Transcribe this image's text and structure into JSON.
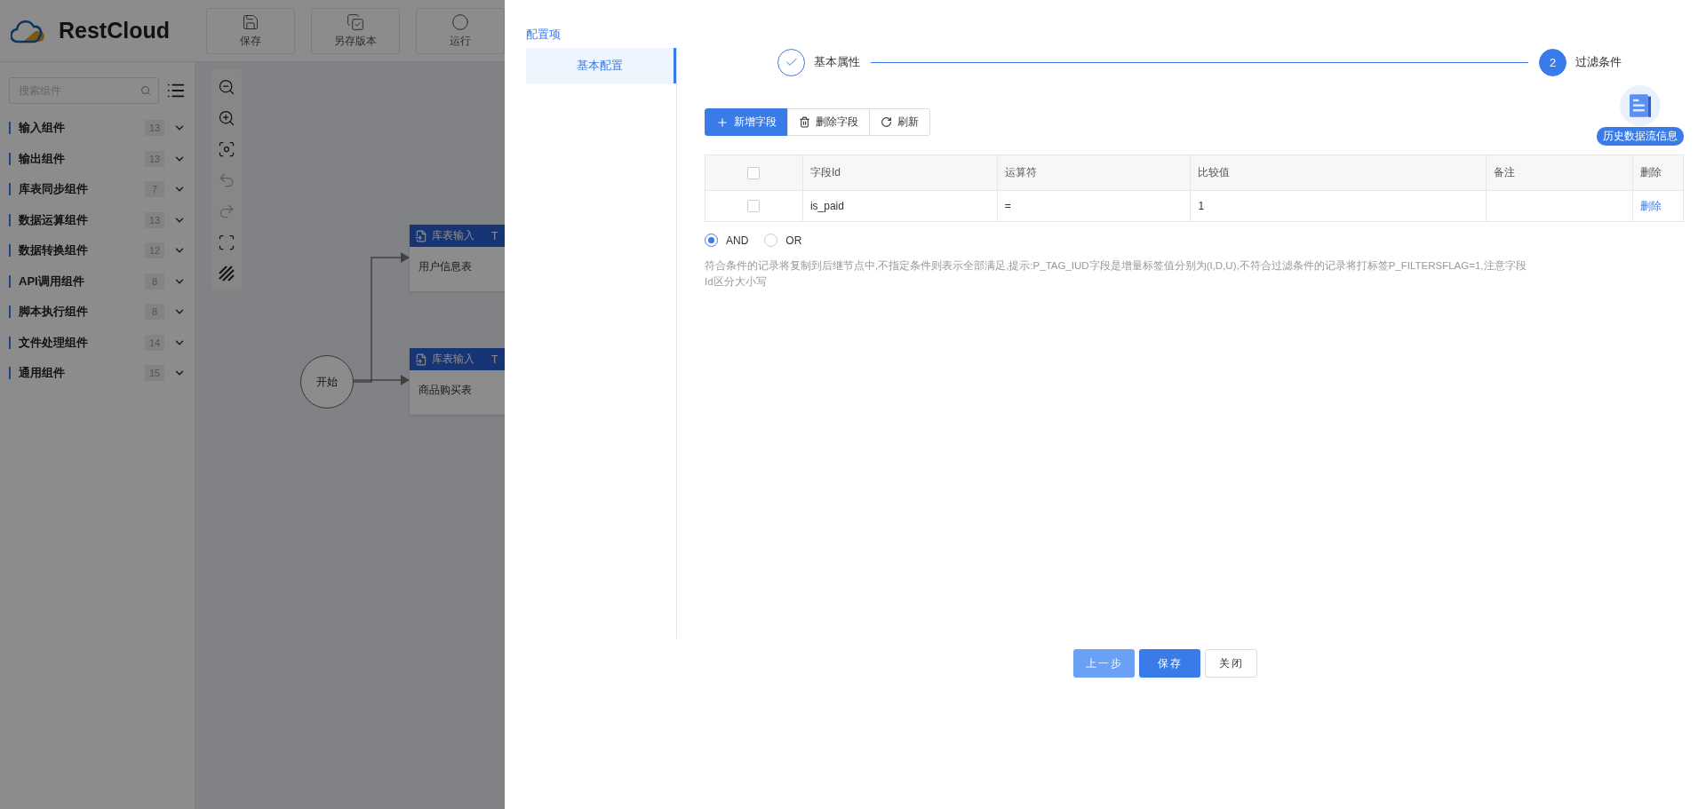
{
  "app": {
    "logo": "RestCloud",
    "toolbar": [
      {
        "kind": "save",
        "label": "保存"
      },
      {
        "kind": "copy",
        "label": "另存版本"
      },
      {
        "kind": "run",
        "label": "运行"
      }
    ],
    "sidebar": {
      "search_placeholder": "搜索组件",
      "categories": [
        {
          "label": "输入组件",
          "count": "13"
        },
        {
          "label": "输出组件",
          "count": "13"
        },
        {
          "label": "库表同步组件",
          "count": "7"
        },
        {
          "label": "数据运算组件",
          "count": "13"
        },
        {
          "label": "数据转换组件",
          "count": "12"
        },
        {
          "label": "API调用组件",
          "count": "8"
        },
        {
          "label": "脚本执行组件",
          "count": "8"
        },
        {
          "label": "文件处理组件",
          "count": "14"
        },
        {
          "label": "通用组件",
          "count": "15"
        }
      ]
    },
    "tools": [
      {
        "kind": "zoom-out",
        "disabled": false
      },
      {
        "kind": "zoom-in",
        "disabled": false
      },
      {
        "kind": "fit",
        "disabled": false
      },
      {
        "kind": "undo",
        "disabled": true
      },
      {
        "kind": "redo",
        "disabled": true
      },
      {
        "kind": "fullscreen",
        "disabled": false
      },
      {
        "kind": "grid",
        "disabled": false
      }
    ],
    "canvas": {
      "start": "开始",
      "nodes": [
        {
          "title": "库表输入",
          "suffix": "T",
          "name": "用户信息表"
        },
        {
          "title": "库表输入",
          "suffix": "T",
          "name": "商品购买表"
        }
      ]
    }
  },
  "drawer": {
    "nav_title": "配置项",
    "nav_items": [
      {
        "label": "基本配置",
        "selected": true
      }
    ],
    "steps": [
      {
        "label": "基本属性",
        "done": true
      },
      {
        "label": "过滤条件",
        "done": false,
        "number": "2"
      }
    ],
    "actions": [
      {
        "kind": "add",
        "label": "新增字段"
      },
      {
        "kind": "delete",
        "label": "删除字段"
      },
      {
        "kind": "refresh",
        "label": "刷新"
      }
    ],
    "history_badge": "历史数据流信息",
    "table": {
      "header_checked": false,
      "columns": [
        "字段Id",
        "运算符",
        "比较值",
        "备注",
        "删除"
      ],
      "rows": [
        {
          "checked": false,
          "cells": [
            "is_paid",
            "=",
            "1",
            ""
          ],
          "action": "删除"
        }
      ]
    },
    "logic": [
      {
        "label": "AND",
        "selected": true
      },
      {
        "label": "OR",
        "selected": false
      }
    ],
    "hint": "符合条件的记录将复制到后继节点中,不指定条件则表示全部满足,提示:P_TAG_IUD字段是增量标签值分别为(I,D,U),不符合过滤条件的记录将打标签P_FILTERSFLAG=1,注意字段Id区分大小写",
    "footer_buttons": [
      {
        "kind": "light",
        "label": "上一步"
      },
      {
        "kind": "primary",
        "label": "保存"
      },
      {
        "kind": "default",
        "label": "关闭"
      }
    ]
  }
}
